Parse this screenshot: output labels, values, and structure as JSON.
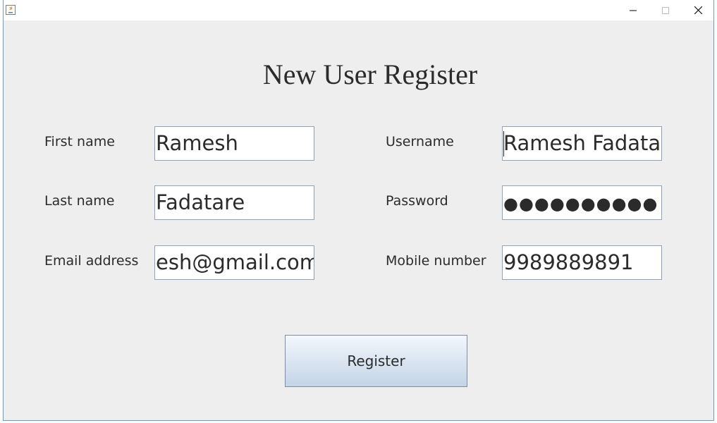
{
  "window": {
    "controls": {
      "minimize_icon": "minimize-icon",
      "maximize_icon": "maximize-icon",
      "close_icon": "close-icon"
    }
  },
  "form": {
    "title": "New User Register",
    "fields": {
      "first_name": {
        "label": "First name",
        "value": "Ramesh"
      },
      "last_name": {
        "label": "Last name",
        "value": "Fadatare"
      },
      "email": {
        "label": "Email address",
        "value": "esh@gmail.com"
      },
      "username": {
        "label": "Username",
        "value": "Ramesh Fadatar"
      },
      "password": {
        "label": "Password",
        "value": "●●●●●●●●●●"
      },
      "mobile": {
        "label": "Mobile number",
        "value": "9989889891"
      }
    },
    "register_label": "Register"
  }
}
